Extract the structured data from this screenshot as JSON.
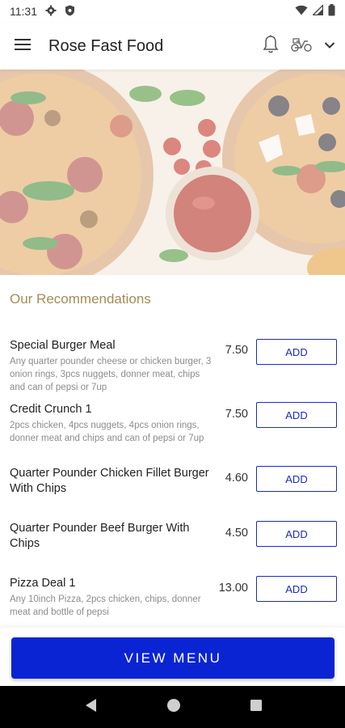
{
  "status_bar": {
    "time": "11:31",
    "left_icons": [
      "gear-icon",
      "shield-icon"
    ],
    "right_icons": [
      "wifi-icon",
      "signal-icon",
      "battery-icon"
    ]
  },
  "app_bar": {
    "title": "Rose Fast Food",
    "icons": [
      "menu-icon",
      "bell-icon",
      "scooter-icon",
      "chevron-down-icon"
    ]
  },
  "hero": {
    "image": "pizza-and-tomatoes-photo"
  },
  "recommendations": {
    "title": "Our Recommendations",
    "items": [
      {
        "name": "Special Burger Meal",
        "description": "Any quarter pounder cheese or chicken burger, 3 onion rings, 3pcs nuggets, donner meat, chips and can of pepsi or 7up",
        "price": "7.50",
        "button": "ADD"
      },
      {
        "name": "Credit Crunch 1",
        "description": "2pcs chicken, 4pcs nuggets, 4pcs onion rings, donner meat and chips and can of pepsi or 7up",
        "price": "7.50",
        "button": "ADD"
      },
      {
        "name": "Quarter Pounder Chicken Fillet Burger With Chips",
        "description": "",
        "price": "4.60",
        "button": "ADD"
      },
      {
        "name": "Quarter Pounder Beef Burger With Chips",
        "description": "",
        "price": "4.50",
        "button": "ADD"
      },
      {
        "name": "Pizza Deal 1",
        "description": "Any 10inch Pizza, 2pcs chicken, chips, donner meat and bottle of pepsi",
        "price": "13.00",
        "button": "ADD"
      }
    ]
  },
  "cta": {
    "label": "VIEW MENU"
  },
  "nav_bar": {
    "icons": [
      "back-icon",
      "home-icon",
      "recents-icon"
    ]
  },
  "colors": {
    "accent": "#0a24d4",
    "add_button": "#1a2bbf",
    "section_title": "#a58c56"
  }
}
